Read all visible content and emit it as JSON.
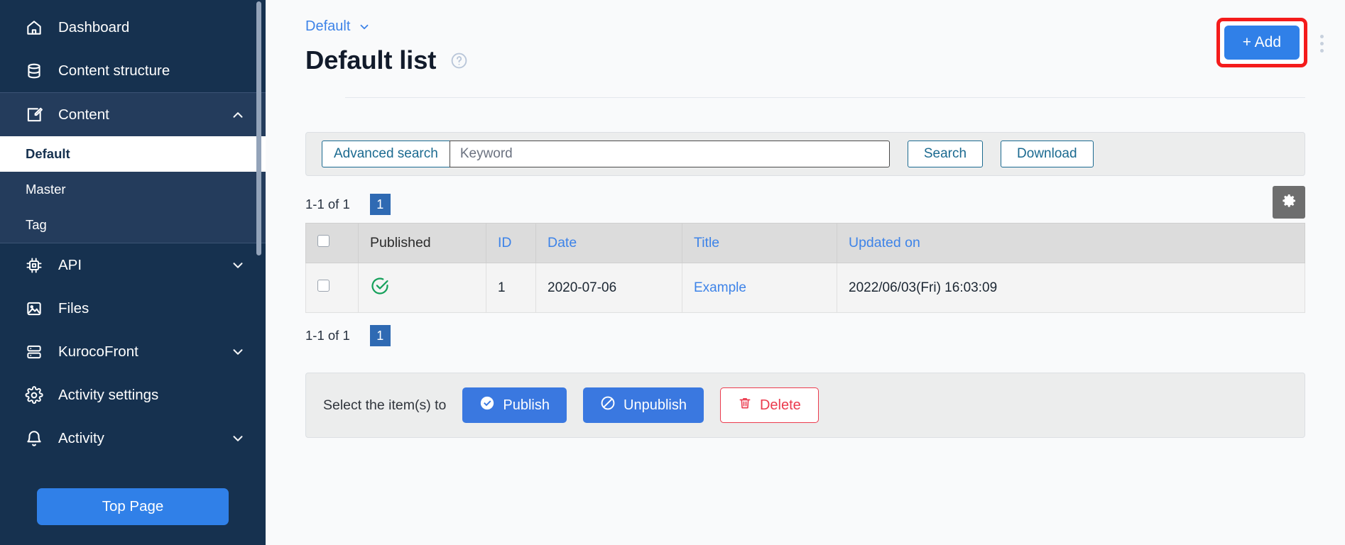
{
  "sidebar": {
    "items": [
      {
        "label": "Dashboard",
        "icon": "home-icon",
        "expandable": false
      },
      {
        "label": "Content structure",
        "icon": "database-icon",
        "expandable": false
      },
      {
        "label": "Content",
        "icon": "edit-square-icon",
        "expandable": true,
        "state": "expanded"
      },
      {
        "label": "API",
        "icon": "chip-icon",
        "expandable": true,
        "state": "collapsed"
      },
      {
        "label": "Files",
        "icon": "image-icon",
        "expandable": false
      },
      {
        "label": "KurocoFront",
        "icon": "server-icon",
        "expandable": true,
        "state": "collapsed"
      },
      {
        "label": "Activity settings",
        "icon": "gear-icon",
        "expandable": false
      },
      {
        "label": "Activity",
        "icon": "bell-icon",
        "expandable": true,
        "state": "collapsed"
      }
    ],
    "content_subitems": [
      {
        "label": "Default",
        "active": true
      },
      {
        "label": "Master",
        "active": false
      },
      {
        "label": "Tag",
        "active": false
      }
    ],
    "top_page_label": "Top Page"
  },
  "header": {
    "breadcrumb": "Default",
    "title": "Default list",
    "help_icon": "question-circle-icon",
    "add_label": "+ Add",
    "kebab_icon": "more-vertical-icon",
    "highlight_color": "#f41b1b",
    "accent_color": "#3080e8"
  },
  "search": {
    "advanced_label": "Advanced search",
    "keyword_value": "",
    "keyword_placeholder": "Keyword",
    "search_label": "Search",
    "download_label": "Download"
  },
  "table": {
    "pager_top": {
      "count_text": "1-1 of 1",
      "page": "1"
    },
    "pager_bottom": {
      "count_text": "1-1 of 1",
      "page": "1"
    },
    "settings_icon": "gear-icon",
    "columns": [
      {
        "label": "",
        "type": "checkbox",
        "link": false
      },
      {
        "label": "Published",
        "link": false
      },
      {
        "label": "ID",
        "link": true
      },
      {
        "label": "Date",
        "link": true
      },
      {
        "label": "Title",
        "link": true
      },
      {
        "label": "Updated on",
        "link": true
      }
    ],
    "rows": [
      {
        "checked": false,
        "published_icon": "check-circle-icon",
        "published_color": "#14a05a",
        "id": "1",
        "date": "2020-07-06",
        "title": "Example",
        "updated_on": "2022/06/03(Fri) 16:03:09"
      }
    ]
  },
  "bulk": {
    "label": "Select the item(s) to",
    "publish_label": "Publish",
    "publish_icon": "check-circle-icon",
    "unpublish_label": "Unpublish",
    "unpublish_icon": "ban-circle-icon",
    "delete_label": "Delete",
    "delete_icon": "trash-icon",
    "danger_color": "#eb3b4e"
  }
}
